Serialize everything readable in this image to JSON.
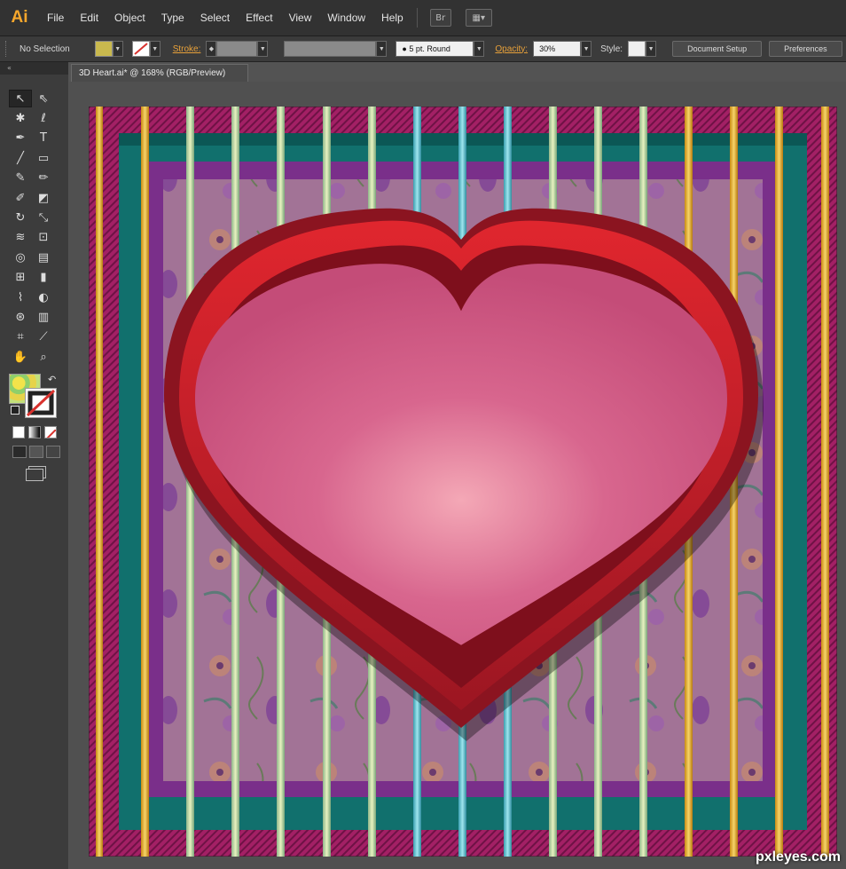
{
  "app": {
    "logo": "Ai"
  },
  "menu": [
    "File",
    "Edit",
    "Object",
    "Type",
    "Select",
    "Effect",
    "View",
    "Window",
    "Help"
  ],
  "menu_icons": {
    "bridge": "Br"
  },
  "control": {
    "selection": "No Selection",
    "stroke_label": "Stroke:",
    "brush": "5 pt. Round",
    "opacity_label": "Opacity:",
    "opacity_value": "30%",
    "style_label": "Style:",
    "document_setup": "Document Setup",
    "preferences": "Preferences"
  },
  "document": {
    "tab": "3D Heart.ai* @ 168% (RGB/Preview)"
  },
  "colors": {
    "accent": "#f7a72c",
    "fill": "#f2e34a",
    "stroke_none": "#d9322e"
  },
  "watermark": "pxleyes.com"
}
